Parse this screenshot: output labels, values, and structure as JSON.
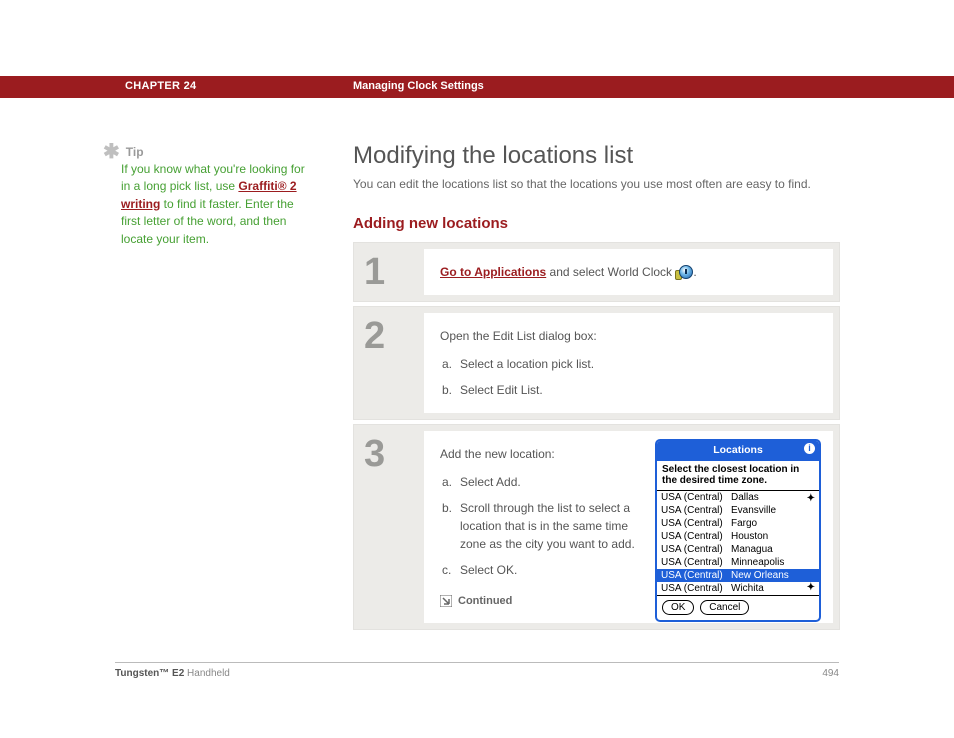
{
  "chapter": {
    "label": "CHAPTER 24",
    "title": "Managing Clock Settings"
  },
  "tip": {
    "label": "Tip",
    "pre": "If you know what you're looking for in a long pick list, use ",
    "link": "Graffiti® 2 writing",
    "post": " to find it faster. Enter the first letter of the word, and then locate your item."
  },
  "main": {
    "heading": "Modifying the locations list",
    "intro": "You can edit the locations list so that the locations you use most often are easy to find.",
    "subheading": "Adding new locations"
  },
  "steps": {
    "s1": {
      "num": "1",
      "link": "Go to Applications",
      "text_after": " and select World Clock ",
      "end": "."
    },
    "s2": {
      "num": "2",
      "lead": "Open the Edit List dialog box:",
      "a": "Select a location pick list.",
      "b": "Select Edit List."
    },
    "s3": {
      "num": "3",
      "lead": "Add the new location:",
      "a": "Select Add.",
      "b": "Scroll through the list to select a location that is in the same time zone as the city you want to add.",
      "c": "Select OK.",
      "continued": "Continued"
    }
  },
  "locations_panel": {
    "title": "Locations",
    "instruction": "Select the closest location in the desired time zone.",
    "rows": [
      {
        "zone": "USA (Central)",
        "city": "Dallas"
      },
      {
        "zone": "USA (Central)",
        "city": "Evansville"
      },
      {
        "zone": "USA (Central)",
        "city": "Fargo"
      },
      {
        "zone": "USA (Central)",
        "city": "Houston"
      },
      {
        "zone": "USA (Central)",
        "city": "Managua"
      },
      {
        "zone": "USA (Central)",
        "city": "Minneapolis"
      },
      {
        "zone": "USA (Central)",
        "city": "New Orleans",
        "selected": true
      },
      {
        "zone": "USA (Central)",
        "city": "Wichita"
      }
    ],
    "ok": "OK",
    "cancel": "Cancel"
  },
  "footer": {
    "product_bold": "Tungsten™ E2",
    "product_rest": " Handheld",
    "page": "494"
  }
}
